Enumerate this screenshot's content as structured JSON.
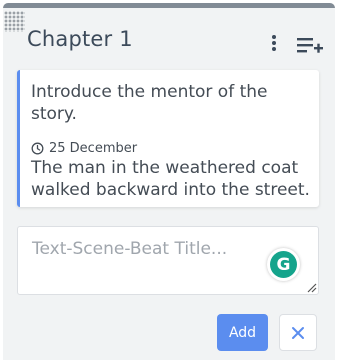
{
  "column": {
    "title": "Chapter 1",
    "accent_color": "#818b95",
    "icons": {
      "drag": "drag-handle-icon",
      "more": "more-vertical-icon",
      "add_list": "playlist-add-icon"
    }
  },
  "beat": {
    "title": "Introduce the mentor of the story.",
    "date_icon": "clock-icon",
    "date": "25 December",
    "text": "The man in the weathered coat walked backward into the street.",
    "accent_color": "#5b8def"
  },
  "new_beat": {
    "placeholder": "Text-Scene-Beat Title...",
    "grammarly_letter": "G",
    "add_label": "Add",
    "close_icon": "close-icon"
  }
}
